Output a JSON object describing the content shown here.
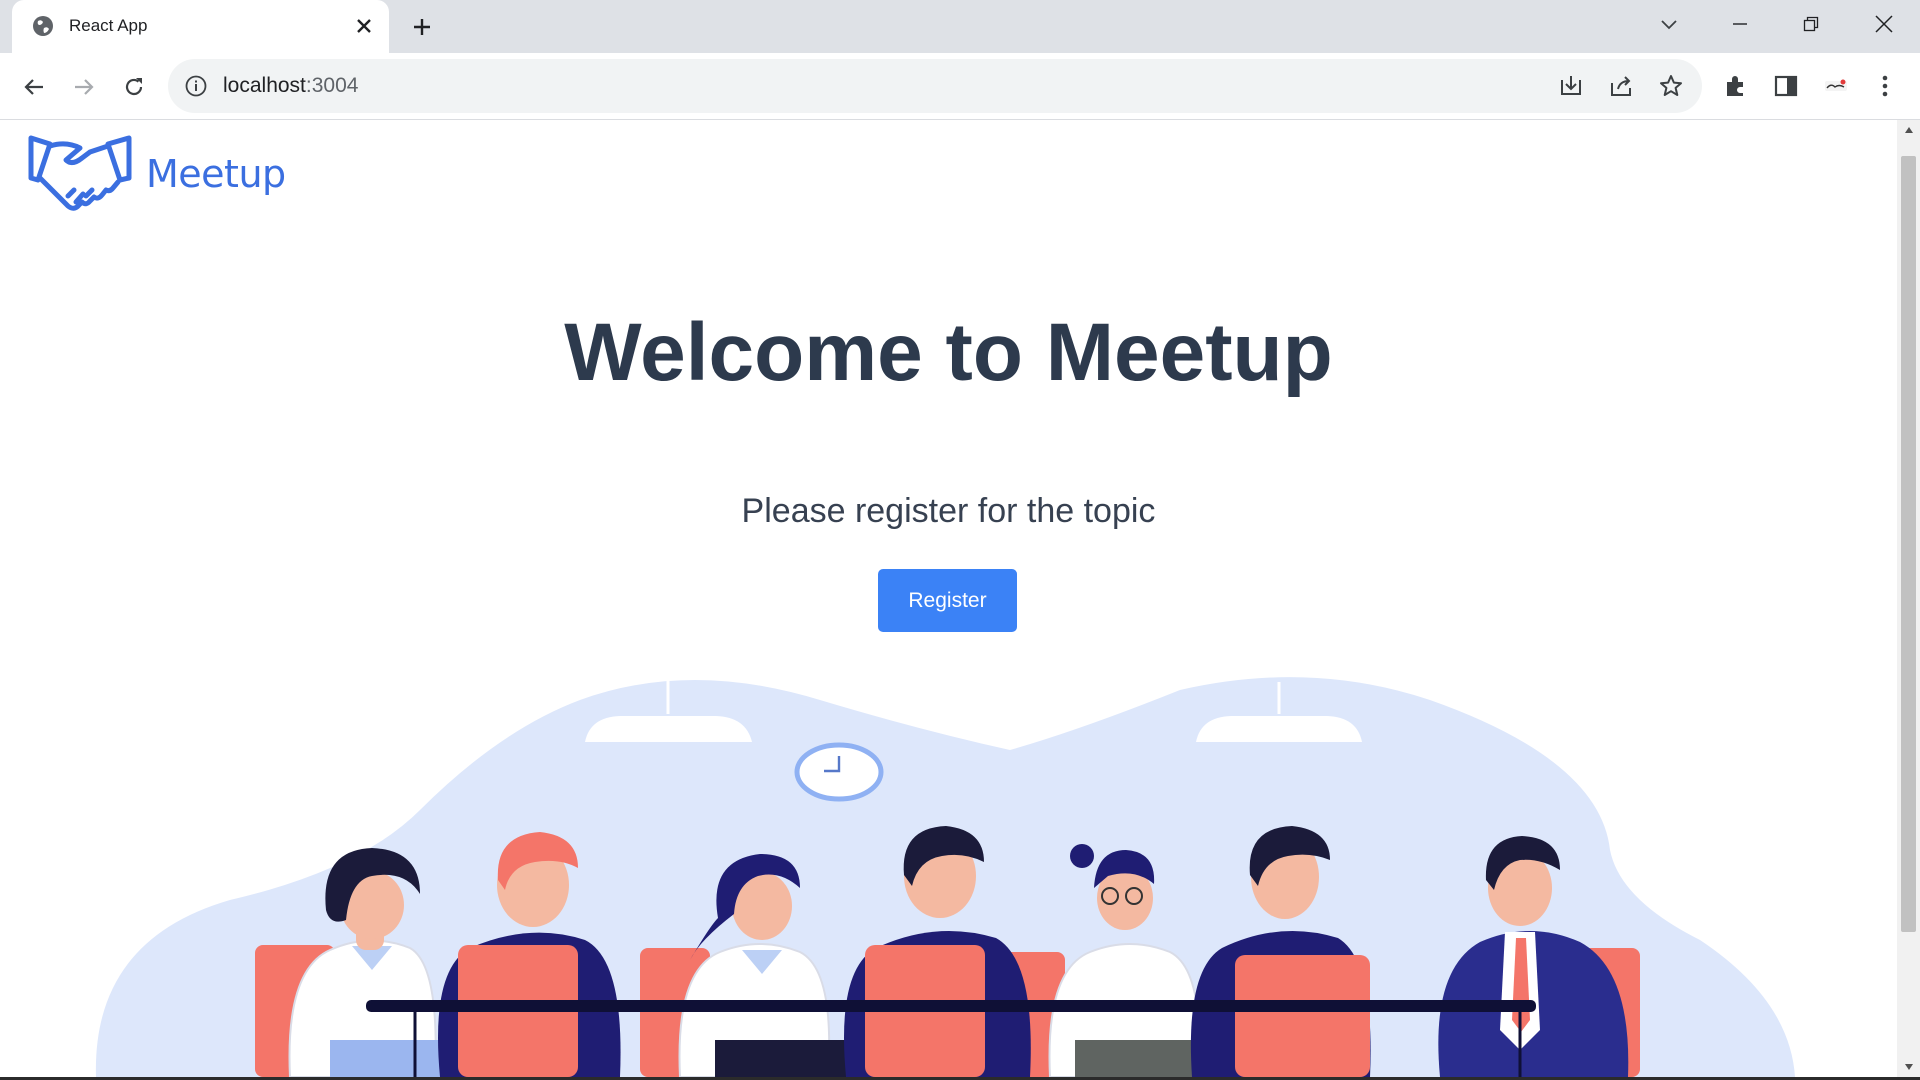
{
  "browser": {
    "tab_title": "React App",
    "url_host": "localhost",
    "url_port": ":3004"
  },
  "page": {
    "logo_text": "Meetup",
    "title": "Welcome to Meetup",
    "subtitle": "Please register for the topic",
    "register_label": "Register"
  },
  "colors": {
    "brand_blue": "#3b6fe0",
    "button_blue": "#3b82f6",
    "title_color": "#2d3a4d",
    "backdrop": "#dde7fb",
    "chair_coral": "#f47569",
    "suit_navy": "#1f1d73"
  }
}
